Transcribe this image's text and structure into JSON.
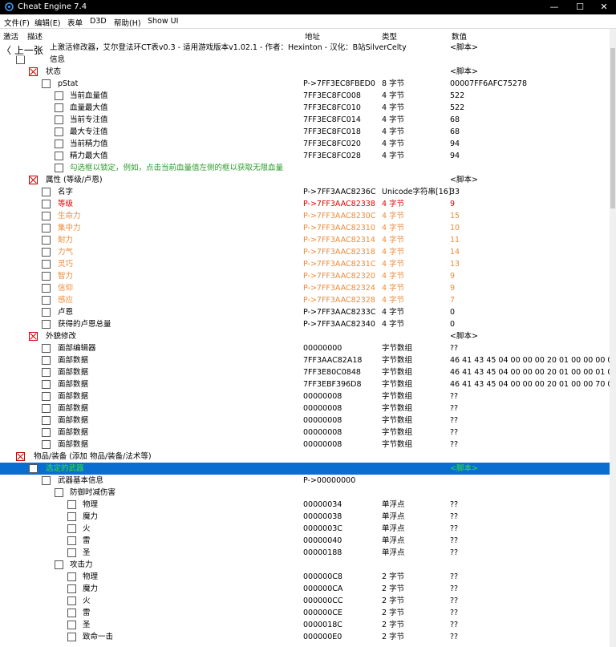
{
  "window": {
    "title": "Cheat Engine 7.4",
    "minimize": "—",
    "maximize": "☐",
    "close": "✕"
  },
  "menu": [
    {
      "label": "文件(F)"
    },
    {
      "label": "编辑(E)"
    },
    {
      "label": "表单"
    },
    {
      "label": "D3D"
    },
    {
      "label": "帮助(H)"
    },
    {
      "label": "Show UI"
    }
  ],
  "columns": {
    "active": "激活",
    "description": "描述",
    "address": "地址",
    "type": "类型",
    "value": "数值"
  },
  "back_nav": "〈 上一张",
  "colors": {
    "selection": "#0a6ed1",
    "red_text": "#e00000",
    "orange_text": "#ee8a38",
    "green_text": "#2a9a2a",
    "selected_green": "#2ee82e"
  },
  "rows": [
    {
      "d": "上激活修改器，艾尔登法环CT表v0.3 - 适用游戏版本v1.02.1 - 作者：Hexinton - 汉化：B站SilverCelty",
      "a": "",
      "t": "",
      "v": "<脚本>"
    },
    {
      "d": "信息",
      "a": "",
      "t": "",
      "v": ""
    },
    {
      "d": "状态",
      "a": "",
      "t": "",
      "v": "<脚本>"
    },
    {
      "d": "pStat",
      "a": "P->7FF3EC8FBED0",
      "t": "8 字节",
      "v": "00007FF6AFC75278"
    },
    {
      "d": "当前血量值",
      "a": "7FF3EC8FC008",
      "t": "4 字节",
      "v": "522"
    },
    {
      "d": "血量最大值",
      "a": "7FF3EC8FC010",
      "t": "4 字节",
      "v": "522"
    },
    {
      "d": "当前专注值",
      "a": "7FF3EC8FC014",
      "t": "4 字节",
      "v": "68"
    },
    {
      "d": "最大专注值",
      "a": "7FF3EC8FC018",
      "t": "4 字节",
      "v": "68"
    },
    {
      "d": "当前精力值",
      "a": "7FF3EC8FC020",
      "t": "4 字节",
      "v": "94"
    },
    {
      "d": "精力最大值",
      "a": "7FF3EC8FC028",
      "t": "4 字节",
      "v": "94"
    },
    {
      "d": "勾选框以锁定，例如，点击当前血量值左侧的框以获取无限血量",
      "a": "",
      "t": "",
      "v": ""
    },
    {
      "d": "属性 (等级/卢恩)",
      "a": "",
      "t": "",
      "v": "<脚本>"
    },
    {
      "d": "名字",
      "a": "P->7FF3AAC8236C",
      "t": "Unicode字符串[16]",
      "v": "33"
    },
    {
      "d": "等级",
      "a": "P->7FF3AAC82338",
      "t": "4 字节",
      "v": "9"
    },
    {
      "d": "生命力",
      "a": "P->7FF3AAC8230C",
      "t": "4 字节",
      "v": "15"
    },
    {
      "d": "集中力",
      "a": "P->7FF3AAC82310",
      "t": "4 字节",
      "v": "10"
    },
    {
      "d": "耐力",
      "a": "P->7FF3AAC82314",
      "t": "4 字节",
      "v": "11"
    },
    {
      "d": "力气",
      "a": "P->7FF3AAC82318",
      "t": "4 字节",
      "v": "14"
    },
    {
      "d": "灵巧",
      "a": "P->7FF3AAC8231C",
      "t": "4 字节",
      "v": "13"
    },
    {
      "d": "智力",
      "a": "P->7FF3AAC82320",
      "t": "4 字节",
      "v": "9"
    },
    {
      "d": "信仰",
      "a": "P->7FF3AAC82324",
      "t": "4 字节",
      "v": "9"
    },
    {
      "d": "感应",
      "a": "P->7FF3AAC82328",
      "t": "4 字节",
      "v": "7"
    },
    {
      "d": "卢恩",
      "a": "P->7FF3AAC8233C",
      "t": "4 字节",
      "v": "0"
    },
    {
      "d": "获得的卢恩总量",
      "a": "P->7FF3AAC82340",
      "t": "4 字节",
      "v": "0"
    },
    {
      "d": "外貌修改",
      "a": "",
      "t": "",
      "v": "<脚本>"
    },
    {
      "d": "面部编辑器",
      "a": "00000000",
      "t": "字节数组",
      "v": "??"
    },
    {
      "d": "面部数据",
      "a": "7FF3AAC82A18",
      "t": "字节数组",
      "v": "46 41 43 45 04 00 00 00 20 01 00 00 00 00 00"
    },
    {
      "d": "面部数据",
      "a": "7FF3E80C0848",
      "t": "字节数组",
      "v": "46 41 43 45 04 00 00 00 20 01 00 00 01 00 00"
    },
    {
      "d": "面部数据",
      "a": "7FF3EBF396D8",
      "t": "字节数组",
      "v": "46 41 43 45 04 00 00 00 20 01 00 00 70 00 00"
    },
    {
      "d": "面部数据",
      "a": "00000008",
      "t": "字节数组",
      "v": "??"
    },
    {
      "d": "面部数据",
      "a": "00000008",
      "t": "字节数组",
      "v": "??"
    },
    {
      "d": "面部数据",
      "a": "00000008",
      "t": "字节数组",
      "v": "??"
    },
    {
      "d": "面部数据",
      "a": "00000008",
      "t": "字节数组",
      "v": "??"
    },
    {
      "d": "面部数据",
      "a": "00000008",
      "t": "字节数组",
      "v": "??"
    },
    {
      "d": "物品/装备 (添加 物品/装备/法术等)",
      "a": "",
      "t": "",
      "v": ""
    },
    {
      "d": "选定的武器",
      "a": "",
      "t": "",
      "v": "<脚本>"
    },
    {
      "d": "武器基本信息",
      "a": "P->00000000",
      "t": "",
      "v": ""
    },
    {
      "d": "防御时减伤害",
      "a": "",
      "t": "",
      "v": ""
    },
    {
      "d": "物理",
      "a": "00000034",
      "t": "单浮点",
      "v": "??"
    },
    {
      "d": "魔力",
      "a": "00000038",
      "t": "单浮点",
      "v": "??"
    },
    {
      "d": "火",
      "a": "0000003C",
      "t": "单浮点",
      "v": "??"
    },
    {
      "d": "雷",
      "a": "00000040",
      "t": "单浮点",
      "v": "??"
    },
    {
      "d": "圣",
      "a": "00000188",
      "t": "单浮点",
      "v": "??"
    },
    {
      "d": "攻击力",
      "a": "",
      "t": "",
      "v": ""
    },
    {
      "d": "物理",
      "a": "000000C8",
      "t": "2 字节",
      "v": "??"
    },
    {
      "d": "魔力",
      "a": "000000CA",
      "t": "2 字节",
      "v": "??"
    },
    {
      "d": "火",
      "a": "000000CC",
      "t": "2 字节",
      "v": "??"
    },
    {
      "d": "雷",
      "a": "000000CE",
      "t": "2 字节",
      "v": "??"
    },
    {
      "d": "圣",
      "a": "0000018C",
      "t": "2 字节",
      "v": "??"
    },
    {
      "d": "致命一击",
      "a": "000000E0",
      "t": "2 字节",
      "v": "??"
    }
  ]
}
